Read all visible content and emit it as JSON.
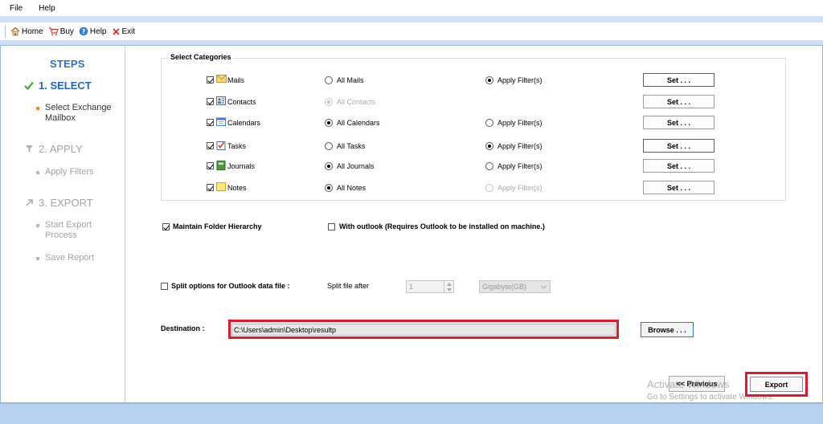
{
  "menu": {
    "items": [
      "File",
      "Help"
    ]
  },
  "toolbar": {
    "home_label": "Home",
    "buy_label": "Buy",
    "help_label": "Help",
    "exit_label": "Exit"
  },
  "sidebar": {
    "title": "STEPS",
    "steps": [
      {
        "label": "1. SELECT",
        "state": "active",
        "icon": "check-icon",
        "substeps": [
          "Select Exchange\nMailbox"
        ]
      },
      {
        "label": "2. APPLY",
        "state": "inactive",
        "icon": "filter-icon",
        "substeps": [
          "Apply Filters"
        ]
      },
      {
        "label": "3. EXPORT",
        "state": "inactive",
        "icon": "arrow-up-right-icon",
        "substeps": [
          "Start Export\nProcess",
          "Save Report"
        ]
      }
    ]
  },
  "categories": {
    "title": "Select Categories",
    "set_label": "Set . . .",
    "rows": [
      {
        "name": "Mails",
        "checked": true,
        "all_label": "All Mails",
        "all_selected": false,
        "all_disabled": false,
        "filter_label": "Apply Filter(s)",
        "filter_selected": true,
        "filter_disabled": false,
        "filter_shown": true
      },
      {
        "name": "Contacts",
        "checked": true,
        "all_label": "All Contacts",
        "all_selected": true,
        "all_disabled": true,
        "filter_label": "",
        "filter_selected": false,
        "filter_disabled": false,
        "filter_shown": false
      },
      {
        "name": "Calendars",
        "checked": true,
        "all_label": "All Calendars",
        "all_selected": true,
        "all_disabled": false,
        "filter_label": "Apply Filter(s)",
        "filter_selected": false,
        "filter_disabled": false,
        "filter_shown": true
      },
      {
        "name": "Tasks",
        "checked": true,
        "all_label": "All Tasks",
        "all_selected": false,
        "all_disabled": false,
        "filter_label": "Apply Filter(s)",
        "filter_selected": true,
        "filter_disabled": false,
        "filter_shown": true
      },
      {
        "name": "Journals",
        "checked": true,
        "all_label": "All Journals",
        "all_selected": true,
        "all_disabled": false,
        "filter_label": "Apply Filter(s)",
        "filter_selected": false,
        "filter_disabled": false,
        "filter_shown": true
      },
      {
        "name": "Notes",
        "checked": true,
        "all_label": "All Notes",
        "all_selected": true,
        "all_disabled": false,
        "filter_label": "Apply Filter(s)",
        "filter_selected": false,
        "filter_disabled": true,
        "filter_shown": true
      }
    ]
  },
  "options": {
    "maintain_hierarchy_label": "Maintain Folder Hierarchy",
    "maintain_hierarchy_checked": true,
    "with_outlook_label": "With outlook (Requires Outlook to be installed on machine.)",
    "with_outlook_checked": false,
    "split_label": "Split options for Outlook data file :",
    "split_checked": false,
    "split_after_label": "Split file after",
    "split_value": "1",
    "split_unit": "Gigabyte(GB)"
  },
  "destination": {
    "label": "Destination :",
    "path": "C:\\Users\\admin\\Desktop\\resultp",
    "browse_label": "Browse . . ."
  },
  "nav": {
    "previous_label": "<< Previous",
    "export_label": "Export"
  },
  "watermark": {
    "title": "Activate Windows",
    "subtitle": "Go to Settings to activate Windows."
  },
  "colors": {
    "accent_blue": "#1f68c6",
    "highlight_red": "#e01a2e",
    "substep_bullet": "#f08a24"
  }
}
